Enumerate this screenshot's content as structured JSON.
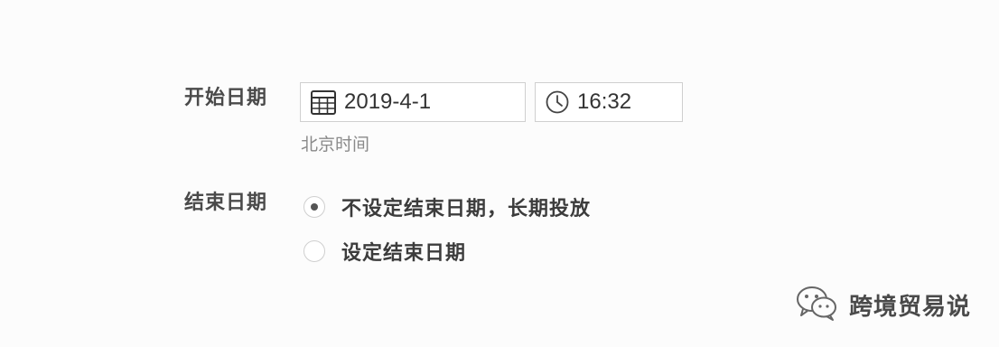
{
  "start_date": {
    "label": "开始日期",
    "date_value": "2019-4-1",
    "date_icon": "calendar-icon",
    "time_value": "16:32",
    "time_icon": "clock-icon",
    "hint": "北京时间"
  },
  "end_date": {
    "label": "结束日期",
    "options": [
      {
        "label": "不设定结束日期，长期投放",
        "checked": true
      },
      {
        "label": "设定结束日期",
        "checked": false
      }
    ]
  },
  "watermark": {
    "text": "跨境贸易说",
    "icon": "wechat-icon"
  }
}
